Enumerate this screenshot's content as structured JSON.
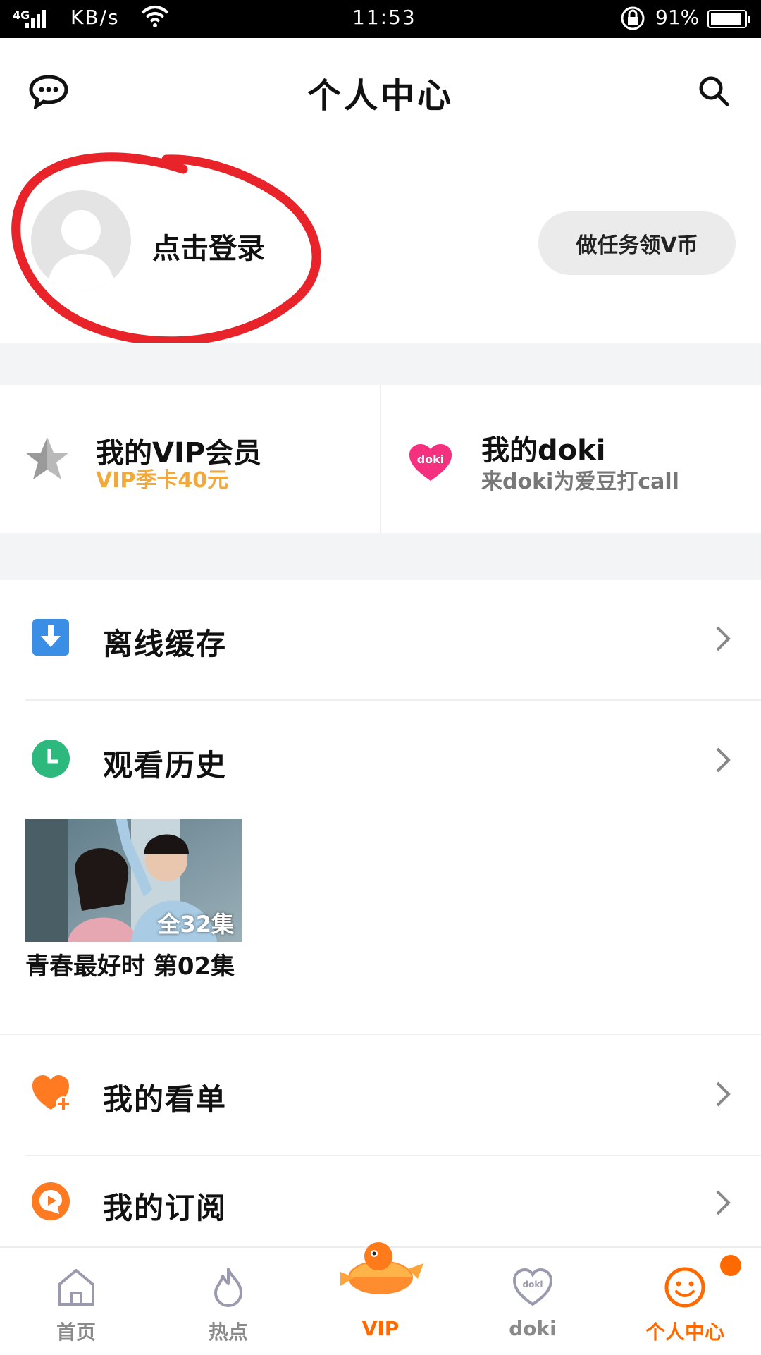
{
  "status_bar": {
    "network": "4G",
    "speed": "KB/s",
    "time": "11:53",
    "battery": "91%",
    "battery_level": 0.91
  },
  "header": {
    "title": "个人中心",
    "message_icon": "chat-bubble-icon",
    "search_icon": "search-icon"
  },
  "profile": {
    "login_label": "点击登录",
    "task_button": "做任务领V币",
    "annotation_color": "#e8232a"
  },
  "vip": {
    "title": "我的VIP会员",
    "subtitle": "VIP季卡40元",
    "subtitle_color": "#f2a93b"
  },
  "doki": {
    "title": "我的doki",
    "subtitle": "来doki为爱豆打call",
    "logo_text": "doki",
    "color": "#f5317f"
  },
  "menu": {
    "offline": "离线缓存",
    "history": "观看历史",
    "watchlist": "我的看单",
    "subscribe": "我的订阅"
  },
  "history_items": [
    {
      "title": "青春最好时  第02集",
      "episodes": "全32集"
    }
  ],
  "tabs": [
    {
      "label": "首页",
      "icon": "home-icon"
    },
    {
      "label": "热点",
      "icon": "flame-icon"
    },
    {
      "label": "VIP",
      "icon": "vip-koi-icon"
    },
    {
      "label": "doki",
      "icon": "doki-heart-icon"
    },
    {
      "label": "个人中心",
      "icon": "smiley-icon",
      "active": true
    }
  ],
  "colors": {
    "accent": "#ff6a00",
    "background_gap": "#f3f4f6",
    "offline_icon": "#3a8ee6",
    "history_icon": "#2db87d",
    "watchlist_icon": "#ff7a21",
    "subscribe_icon": "#ff7a21"
  }
}
